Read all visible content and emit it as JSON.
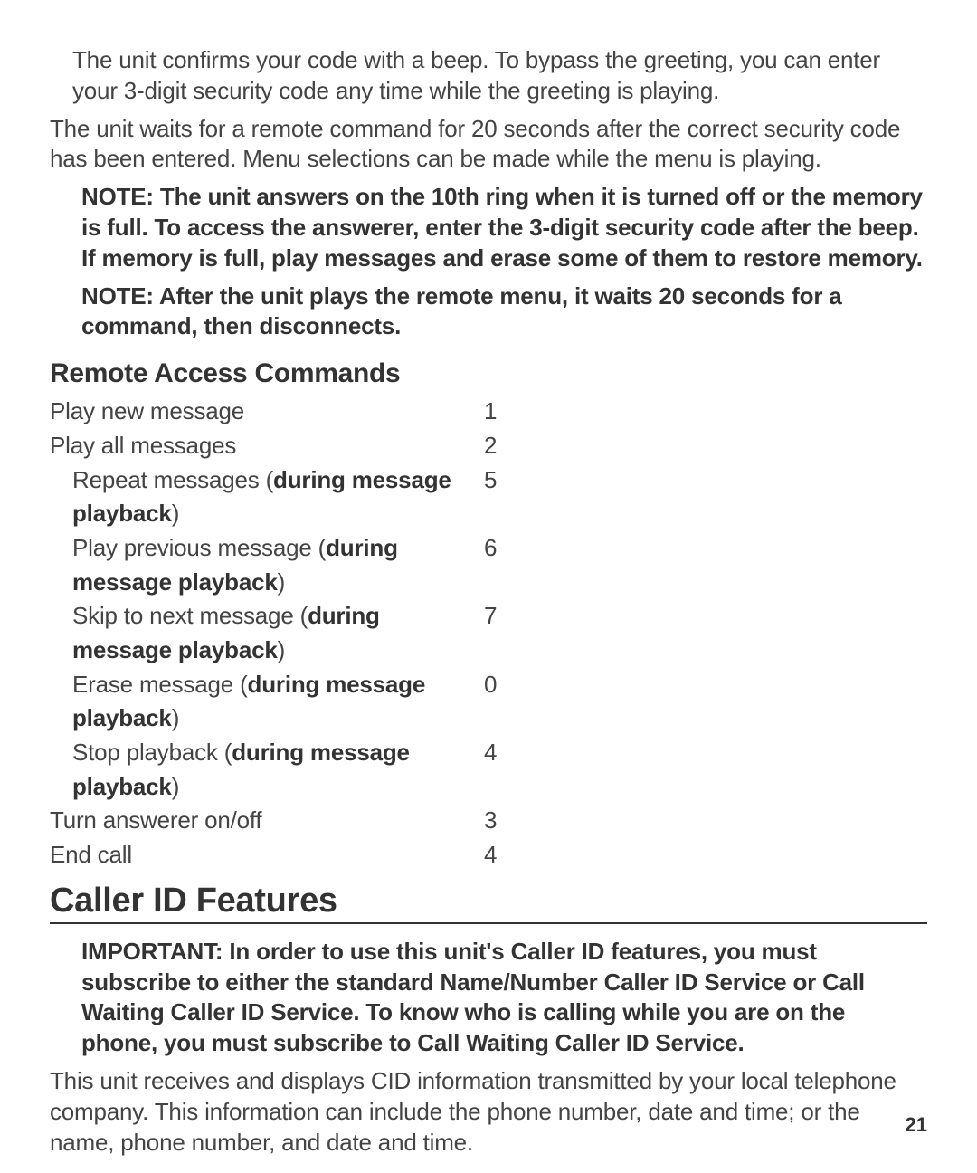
{
  "intro": {
    "p1": "The unit confirms your code with a beep. To bypass the greeting, you can enter your 3-digit security code any time while the greeting is playing.",
    "p2": "The unit waits for a remote command for 20 seconds after the correct security code has been entered. Menu selections can be made while the menu is playing.",
    "note1": "NOTE: The unit answers on the 10th ring when it is turned off or the memory is full. To access the answerer, enter the 3-digit security code after the beep. If memory is full, play messages and erase some of them to restore memory.",
    "note2": "NOTE: After the unit plays the remote menu, it waits 20 seconds for a command, then disconnects."
  },
  "remote": {
    "heading": "Remote Access Commands",
    "rows": [
      {
        "pre": "Play new message",
        "bold": "",
        "post": "",
        "code": "1",
        "indent": 0
      },
      {
        "pre": "Play all messages",
        "bold": "",
        "post": "",
        "code": "2",
        "indent": 0
      },
      {
        "pre": "Repeat messages (",
        "bold": "during message playback",
        "post": ")",
        "code": "5",
        "indent": 1
      },
      {
        "pre": "Play previous message (",
        "bold": "during message playback",
        "post": ")",
        "code": "6",
        "indent": 1
      },
      {
        "pre": "Skip to next message (",
        "bold": "during message playback",
        "post": ")",
        "code": "7",
        "indent": 1
      },
      {
        "pre": "Erase message (",
        "bold": "during message playback",
        "post": ")",
        "code": "0",
        "indent": 1
      },
      {
        "pre": "Stop playback (",
        "bold": "during message playback",
        "post": ")",
        "code": "4",
        "indent": 1
      },
      {
        "pre": "Turn answerer on/off",
        "bold": "",
        "post": "",
        "code": "3",
        "indent": 0
      },
      {
        "pre": "End call",
        "bold": "",
        "post": "",
        "code": "4",
        "indent": 0
      }
    ]
  },
  "caller_id": {
    "heading": "Caller ID Features",
    "important": "IMPORTANT: In order to use this unit's Caller ID features, you must subscribe to either the standard Name/Number Caller ID Service or Call Waiting Caller ID Service. To know who is calling while you are on the phone, you must subscribe to Call Waiting Caller ID Service.",
    "p1": "This unit receives and displays CID information transmitted by your local telephone company. This information can include the phone number, date and time; or the name, phone number, and date and time."
  },
  "page_number": "21"
}
